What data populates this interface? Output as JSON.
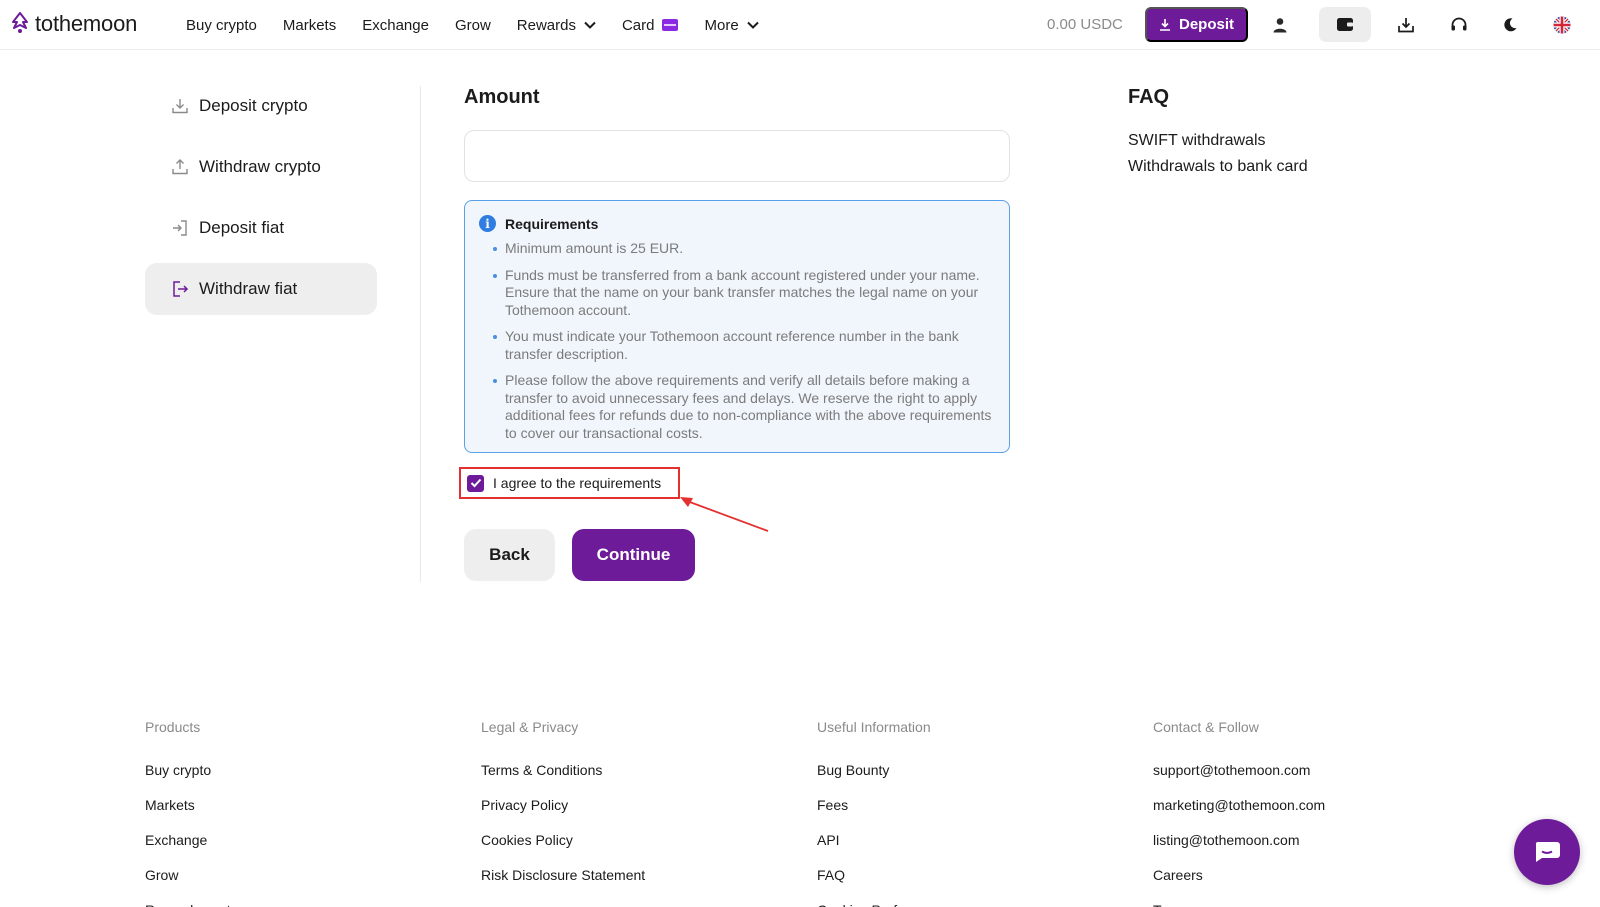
{
  "header": {
    "brand": "tothemoon",
    "nav": [
      {
        "label": "Buy crypto"
      },
      {
        "label": "Markets"
      },
      {
        "label": "Exchange"
      },
      {
        "label": "Grow"
      },
      {
        "label": "Rewards"
      },
      {
        "label": "Card"
      },
      {
        "label": "More"
      }
    ],
    "balance": "0.00 USDC",
    "deposit_label": "Deposit"
  },
  "sidebar": {
    "items": [
      {
        "label": "Deposit crypto",
        "icon": "download-icon"
      },
      {
        "label": "Withdraw crypto",
        "icon": "upload-icon"
      },
      {
        "label": "Deposit fiat",
        "icon": "login-icon"
      },
      {
        "label": "Withdraw fiat",
        "icon": "logout-icon",
        "active": true
      }
    ]
  },
  "main": {
    "amount_title": "Amount",
    "amount_value": "",
    "requirements": {
      "title": "Requirements",
      "items": [
        "Minimum amount is 25 EUR.",
        "Funds must be transferred from a bank account registered under your name. Ensure that the name on your bank transfer matches the legal name on your Tothemoon account.",
        "You must indicate your Tothemoon account reference number in the bank transfer description.",
        "Please follow the above requirements and verify all details before making a transfer to avoid unnecessary fees and delays. We reserve the right to apply additional fees for refunds due to non-compliance with the above requirements to cover our transactional costs."
      ]
    },
    "agree_label": "I agree to the requirements",
    "agree_checked": true,
    "back_label": "Back",
    "continue_label": "Continue"
  },
  "faq": {
    "title": "FAQ",
    "links": [
      "SWIFT withdrawals",
      "Withdrawals to bank card"
    ]
  },
  "footer": {
    "columns": [
      {
        "title": "Products",
        "links": [
          "Buy crypto",
          "Markets",
          "Exchange",
          "Grow",
          "Rewards center"
        ]
      },
      {
        "title": "Legal & Privacy",
        "links": [
          "Terms & Conditions",
          "Privacy Policy",
          "Cookies Policy",
          "Risk Disclosure Statement"
        ]
      },
      {
        "title": "Useful Information",
        "links": [
          "Bug Bounty",
          "Fees",
          "API",
          "FAQ",
          "Cookies Preferences"
        ]
      },
      {
        "title": "Contact & Follow",
        "links": [
          "support@tothemoon.com",
          "marketing@tothemoon.com",
          "listing@tothemoon.com",
          "Careers",
          "Team"
        ]
      }
    ]
  },
  "colors": {
    "brand": "#6e1b99",
    "info": "#2f7de1",
    "highlight": "#e53030"
  }
}
